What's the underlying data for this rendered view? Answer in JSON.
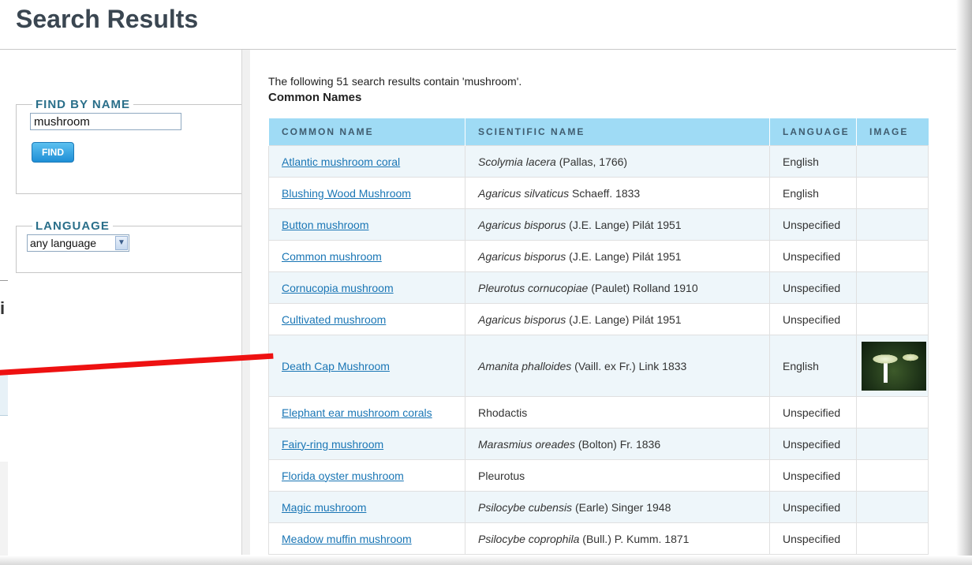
{
  "page": {
    "title": "Search Results",
    "background_fragment_text": "i"
  },
  "sidebar": {
    "find_legend": "FIND BY NAME",
    "search_value": "mushroom",
    "find_button": "FIND",
    "language_legend": "LANGUAGE",
    "language_selected": "any language"
  },
  "results": {
    "summary": "The following 51 search results contain 'mushroom'.",
    "section_title": "Common Names",
    "columns": [
      "COMMON NAME",
      "SCIENTIFIC NAME",
      "LANGUAGE",
      "IMAGE"
    ],
    "rows": [
      {
        "common": "Atlantic mushroom coral",
        "sci_italic": "Scolymia lacera",
        "sci_rest": " (Pallas, 1766)",
        "language": "English"
      },
      {
        "common": "Blushing Wood Mushroom",
        "sci_italic": "Agaricus silvaticus",
        "sci_rest": " Schaeff. 1833",
        "language": "English"
      },
      {
        "common": "Button mushroom",
        "sci_italic": "Agaricus bisporus",
        "sci_rest": " (J.E. Lange) Pilát 1951",
        "language": "Unspecified"
      },
      {
        "common": "Common mushroom",
        "sci_italic": "Agaricus bisporus",
        "sci_rest": " (J.E. Lange) Pilát 1951",
        "language": "Unspecified"
      },
      {
        "common": "Cornucopia mushroom",
        "sci_italic": "Pleurotus cornucopiae",
        "sci_rest": " (Paulet) Rolland 1910",
        "language": "Unspecified"
      },
      {
        "common": "Cultivated mushroom",
        "sci_italic": "Agaricus bisporus",
        "sci_rest": " (J.E. Lange) Pilát 1951",
        "language": "Unspecified"
      },
      {
        "common": "Death Cap Mushroom",
        "sci_italic": "Amanita phalloides",
        "sci_rest": " (Vaill. ex Fr.) Link 1833",
        "language": "English"
      },
      {
        "common": "Elephant ear mushroom corals",
        "sci_italic": "",
        "sci_rest": "Rhodactis",
        "language": "Unspecified"
      },
      {
        "common": "Fairy-ring mushroom",
        "sci_italic": "Marasmius oreades",
        "sci_rest": " (Bolton) Fr. 1836",
        "language": "Unspecified"
      },
      {
        "common": "Florida oyster mushroom",
        "sci_italic": "",
        "sci_rest": "Pleurotus",
        "language": "Unspecified"
      },
      {
        "common": "Magic mushroom",
        "sci_italic": "Psilocybe cubensis",
        "sci_rest": " (Earle) Singer 1948",
        "language": "Unspecified"
      },
      {
        "common": "Meadow muffin mushroom",
        "sci_italic": "Psilocybe coprophila",
        "sci_rest": " (Bull.) P. Kumm. 1871",
        "language": "Unspecified"
      }
    ]
  },
  "colors": {
    "header_bg": "#9fdbf5",
    "link": "#1a76b5",
    "annotation_line": "#ee1111",
    "legend_text": "#2a6f8a"
  }
}
